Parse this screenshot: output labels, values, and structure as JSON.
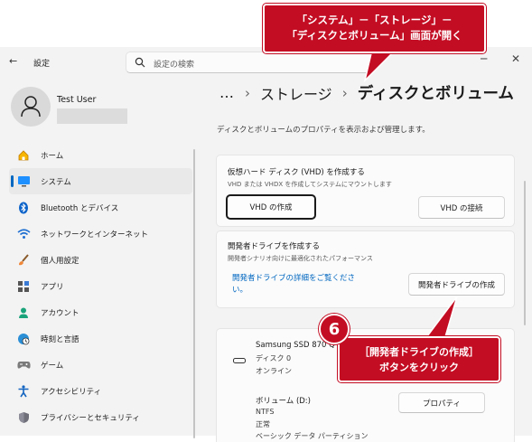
{
  "window": {
    "title": "設定",
    "search_placeholder": "設定の検索",
    "minimize": "─",
    "close": "✕"
  },
  "user": {
    "name": "Test User"
  },
  "sidebar": {
    "items": [
      {
        "label": "ホーム",
        "icon": "home-icon"
      },
      {
        "label": "システム",
        "icon": "display-icon"
      },
      {
        "label": "Bluetooth とデバイス",
        "icon": "bluetooth-icon"
      },
      {
        "label": "ネットワークとインターネット",
        "icon": "wifi-icon"
      },
      {
        "label": "個人用設定",
        "icon": "brush-icon"
      },
      {
        "label": "アプリ",
        "icon": "apps-icon"
      },
      {
        "label": "アカウント",
        "icon": "person-icon"
      },
      {
        "label": "時刻と言語",
        "icon": "globe-clock-icon"
      },
      {
        "label": "ゲーム",
        "icon": "gamepad-icon"
      },
      {
        "label": "アクセシビリティ",
        "icon": "accessibility-icon"
      },
      {
        "label": "プライバシーとセキュリティ",
        "icon": "shield-icon"
      }
    ],
    "active_index": 1
  },
  "breadcrumb": {
    "more": "…",
    "middle": "ストレージ",
    "current": "ディスクとボリューム"
  },
  "main": {
    "description": "ディスクとボリュームのプロパティを表示および管理します。",
    "vhd": {
      "title": "仮想ハード ディスク (VHD) を作成する",
      "subtitle": "VHD または VHDX を作成してシステムにマウントします",
      "create_button": "VHD の作成",
      "attach_button": "VHD の接続"
    },
    "dev_drive": {
      "title": "開発者ドライブを作成する",
      "subtitle": "開発者シナリオ向けに最適化されたパフォーマンス",
      "link": "開発者ドライブの詳細をご覧ください。",
      "button": "開発者ドライブの作成"
    },
    "disk": {
      "name": "Samsung SSD 870 Q",
      "number": "ディスク 0",
      "status": "オンライン"
    },
    "volume": {
      "name": "ボリューム (D:)",
      "fs": "NTFS",
      "health": "正常",
      "type": "ベーシック データ パーティション",
      "properties_button": "プロパティ"
    }
  },
  "annotations": {
    "top_line1": "「システム」－「ストレージ」－",
    "top_line2": "「ディスクとボリューム」画面が開く",
    "step_number": "6",
    "bottom_line1": "［開発者ドライブの作成］",
    "bottom_line2": "ボタンをクリック",
    "color": "#c30d23"
  }
}
